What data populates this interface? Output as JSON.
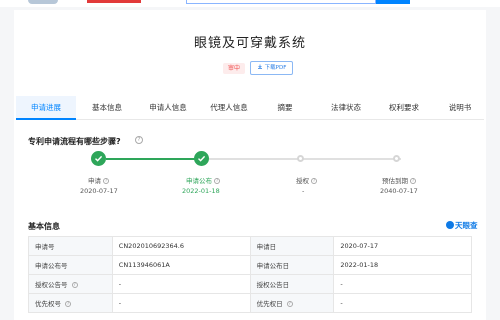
{
  "patent": {
    "title": "眼镜及可穿戴系统",
    "status": "审中",
    "download_label": "下载PDF"
  },
  "tabs": [
    {
      "label": "申请进展",
      "active": true
    },
    {
      "label": "基本信息"
    },
    {
      "label": "申请人信息"
    },
    {
      "label": "代理人信息"
    },
    {
      "label": "摘要"
    },
    {
      "label": "法律状态"
    },
    {
      "label": "权利要求"
    },
    {
      "label": "说明书"
    }
  ],
  "process": {
    "title": "专利申请流程有哪些步骤?",
    "steps": [
      {
        "label": "申请",
        "date": "2020-07-17",
        "state": "done"
      },
      {
        "label": "申请公布",
        "date": "2022-01-18",
        "state": "current"
      },
      {
        "label": "授权",
        "date": "-",
        "state": "pending"
      },
      {
        "label": "预估到期",
        "date": "2040-07-17",
        "state": "pending"
      }
    ]
  },
  "basic": {
    "title": "基本信息",
    "brand": "天眼查",
    "rows": [
      {
        "k1": "申请号",
        "v1": "CN202010692364.6",
        "k2": "申请日",
        "v2": "2020-07-17"
      },
      {
        "k1": "申请公布号",
        "v1": "CN113946061A",
        "k2": "申请公布日",
        "v2": "2022-01-18"
      },
      {
        "k1": "授权公告号",
        "v1": "-",
        "k2": "授权公告日",
        "v2": "-"
      },
      {
        "k1": "优先权号",
        "v1": "-",
        "k2": "优先权日",
        "v2": "-"
      }
    ]
  },
  "colors": {
    "accent": "#0084ff",
    "success": "#2ea65a",
    "status_red": "#f04b4b"
  }
}
